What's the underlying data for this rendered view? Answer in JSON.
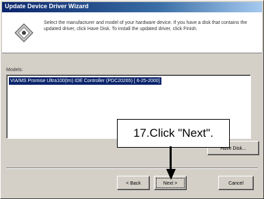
{
  "window": {
    "title": "Update Device Driver Wizard"
  },
  "header": {
    "icon": "wizard-diamond-icon",
    "instructions": "Select the manufacturer and model of your hardware device. If you have a disk that contains the updated driver, click Have Disk. To install the updated driver, click Finish."
  },
  "models": {
    "label": "Models:",
    "items": [
      "VIA/MS Promise Ultra100(tm) IDE Controller (PDC20265) [ 6-25-2000]"
    ],
    "selected_index": 0
  },
  "buttons": {
    "have_disk": "Have Disk...",
    "back": "< Back",
    "next": "Next >",
    "cancel": "Cancel"
  },
  "annotation": {
    "text": "17.Click \"Next\"."
  },
  "colors": {
    "selection": "#0a246a",
    "title_bar_start": "#0a246a",
    "face": "#d4d0c8"
  }
}
